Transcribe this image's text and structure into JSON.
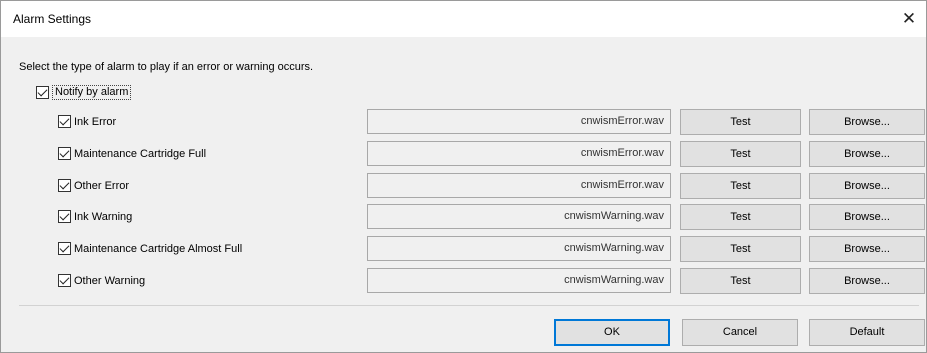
{
  "window": {
    "title": "Alarm Settings",
    "close_glyph": "✕"
  },
  "instruction": "Select the type of alarm to play if an error or warning occurs.",
  "notify": {
    "label": "Notify by alarm",
    "checked": true
  },
  "alarms": [
    {
      "label": "Ink Error",
      "checked": true,
      "file": "cnwismError.wav",
      "test_label": "Test",
      "browse_label": "Browse..."
    },
    {
      "label": "Maintenance Cartridge Full",
      "checked": true,
      "file": "cnwismError.wav",
      "test_label": "Test",
      "browse_label": "Browse..."
    },
    {
      "label": "Other Error",
      "checked": true,
      "file": "cnwismError.wav",
      "test_label": "Test",
      "browse_label": "Browse..."
    },
    {
      "label": "Ink Warning",
      "checked": true,
      "file": "cnwismWarning.wav",
      "test_label": "Test",
      "browse_label": "Browse..."
    },
    {
      "label": "Maintenance Cartridge Almost Full",
      "checked": true,
      "file": "cnwismWarning.wav",
      "test_label": "Test",
      "browse_label": "Browse..."
    },
    {
      "label": "Other Warning",
      "checked": true,
      "file": "cnwismWarning.wav",
      "test_label": "Test",
      "browse_label": "Browse..."
    }
  ],
  "footer": {
    "ok_label": "OK",
    "cancel_label": "Cancel",
    "default_label": "Default"
  }
}
